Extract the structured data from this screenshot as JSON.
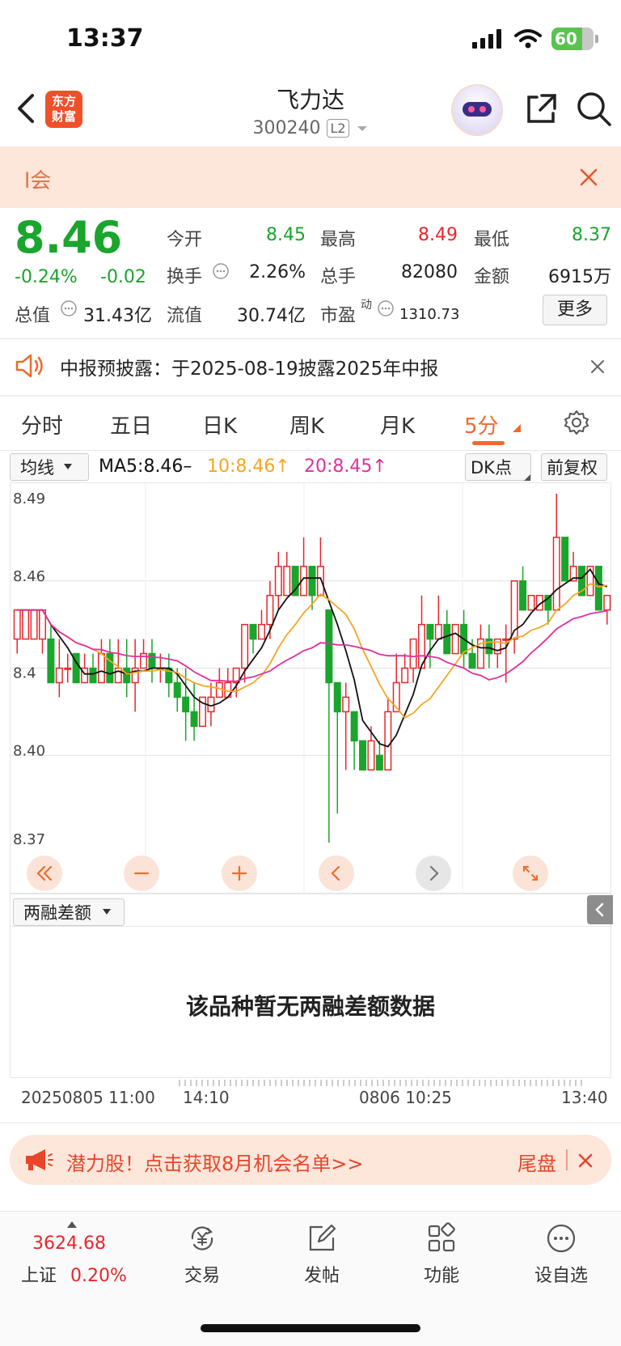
{
  "status": {
    "time": "13:37",
    "battery": "60"
  },
  "header": {
    "logo_line1": "东方",
    "logo_line2": "财富",
    "title": "飞力达",
    "code": "300240",
    "level": "L2"
  },
  "banner": {
    "text": "l会"
  },
  "quote": {
    "price": "8.46",
    "change_pct": "-0.24%",
    "change_abs": "-0.02",
    "open_label": "今开",
    "open": "8.45",
    "high_label": "最高",
    "high": "8.49",
    "low_label": "最低",
    "low": "8.37",
    "turnover_label": "换手",
    "turnover": "2.26%",
    "volume_label": "总手",
    "volume": "82080",
    "amount_label": "金额",
    "amount": "6915万",
    "mktcap_label": "总值",
    "mktcap": "31.43亿",
    "float_label": "流值",
    "float": "30.74亿",
    "pe_label": "市盈",
    "pe_sup": "动",
    "pe": "1310.73",
    "more": "更多"
  },
  "notice": {
    "text": "中报预披露：于2025-08-19披露2025年中报"
  },
  "tabs": [
    "分时",
    "五日",
    "日K",
    "周K",
    "月K",
    "5分"
  ],
  "indicator": {
    "selector": "均线",
    "ma5": "MA5:8.46–",
    "ma10": "10:8.46↑",
    "ma20": "20:8.45↑",
    "dk": "DK点",
    "adjust": "前复权"
  },
  "colors": {
    "up": "#e8262c",
    "down": "#1aa52c",
    "ma5": "#111111",
    "ma10": "#f5a623",
    "ma20": "#e0309a",
    "accent": "#ef6a2d"
  },
  "chart_data": {
    "type": "candlestick",
    "ylim": [
      8.37,
      8.49
    ],
    "yticks": [
      "8.49",
      "8.46",
      "8.4",
      "8.40",
      "8.37"
    ],
    "xticks": [
      "20250805 11:00",
      "14:10",
      "0806 10:25",
      "13:40"
    ],
    "candles": [
      [
        8.44,
        8.45,
        8.445,
        8.435
      ],
      [
        8.44,
        8.45,
        8.44,
        8.44
      ],
      [
        8.44,
        8.45,
        8.445,
        8.44
      ],
      [
        8.44,
        8.45,
        8.445,
        8.435
      ],
      [
        8.44,
        8.425,
        8.445,
        8.425
      ],
      [
        8.425,
        8.43,
        8.44,
        8.42
      ],
      [
        8.43,
        8.43,
        8.435,
        8.425
      ],
      [
        8.435,
        8.425,
        8.435,
        8.425
      ],
      [
        8.425,
        8.43,
        8.435,
        8.425
      ],
      [
        8.43,
        8.425,
        8.435,
        8.425
      ],
      [
        8.425,
        8.435,
        8.44,
        8.425
      ],
      [
        8.435,
        8.425,
        8.44,
        8.425
      ],
      [
        8.425,
        8.43,
        8.44,
        8.425
      ],
      [
        8.43,
        8.425,
        8.44,
        8.42
      ],
      [
        8.425,
        8.43,
        8.44,
        8.415
      ],
      [
        8.43,
        8.435,
        8.44,
        8.43
      ],
      [
        8.435,
        8.43,
        8.44,
        8.425
      ],
      [
        8.43,
        8.43,
        8.435,
        8.425
      ],
      [
        8.43,
        8.425,
        8.435,
        8.42
      ],
      [
        8.425,
        8.42,
        8.43,
        8.415
      ],
      [
        8.42,
        8.415,
        8.43,
        8.405
      ],
      [
        8.415,
        8.41,
        8.425,
        8.405
      ],
      [
        8.41,
        8.42,
        8.42,
        8.41
      ],
      [
        8.415,
        8.42,
        8.425,
        8.41
      ],
      [
        8.42,
        8.425,
        8.43,
        8.42
      ],
      [
        8.42,
        8.425,
        8.43,
        8.42
      ],
      [
        8.425,
        8.43,
        8.43,
        8.42
      ],
      [
        8.43,
        8.445,
        8.445,
        8.425
      ],
      [
        8.445,
        8.44,
        8.445,
        8.435
      ],
      [
        8.44,
        8.445,
        8.45,
        8.44
      ],
      [
        8.445,
        8.455,
        8.46,
        8.44
      ],
      [
        8.455,
        8.465,
        8.47,
        8.45
      ],
      [
        8.455,
        8.465,
        8.47,
        8.455
      ],
      [
        8.465,
        8.455,
        8.465,
        8.455
      ],
      [
        8.455,
        8.465,
        8.475,
        8.455
      ],
      [
        8.465,
        8.455,
        8.465,
        8.45
      ],
      [
        8.455,
        8.465,
        8.475,
        8.455
      ],
      [
        8.45,
        8.425,
        8.45,
        8.37
      ],
      [
        8.425,
        8.415,
        8.425,
        8.38
      ],
      [
        8.415,
        8.42,
        8.425,
        8.395
      ],
      [
        8.415,
        8.405,
        8.415,
        8.395
      ],
      [
        8.405,
        8.395,
        8.405,
        8.395
      ],
      [
        8.395,
        8.405,
        8.41,
        8.395
      ],
      [
        8.4,
        8.395,
        8.405,
        8.395
      ],
      [
        8.395,
        8.415,
        8.42,
        8.395
      ],
      [
        8.415,
        8.425,
        8.435,
        8.415
      ],
      [
        8.425,
        8.43,
        8.435,
        8.425
      ],
      [
        8.43,
        8.44,
        8.44,
        8.425
      ],
      [
        8.43,
        8.445,
        8.455,
        8.43
      ],
      [
        8.445,
        8.44,
        8.445,
        8.43
      ],
      [
        8.44,
        8.445,
        8.455,
        8.44
      ],
      [
        8.445,
        8.435,
        8.45,
        8.435
      ],
      [
        8.435,
        8.445,
        8.445,
        8.435
      ],
      [
        8.445,
        8.435,
        8.45,
        8.43
      ],
      [
        8.435,
        8.43,
        8.44,
        8.43
      ],
      [
        8.43,
        8.44,
        8.445,
        8.43
      ],
      [
        8.44,
        8.435,
        8.445,
        8.43
      ],
      [
        8.435,
        8.44,
        8.44,
        8.43
      ],
      [
        8.44,
        8.44,
        8.445,
        8.425
      ],
      [
        8.44,
        8.46,
        8.46,
        8.435
      ],
      [
        8.46,
        8.45,
        8.465,
        8.45
      ],
      [
        8.45,
        8.455,
        8.455,
        8.45
      ],
      [
        8.45,
        8.455,
        8.455,
        8.45
      ],
      [
        8.455,
        8.45,
        8.455,
        8.445
      ],
      [
        8.45,
        8.475,
        8.49,
        8.45
      ],
      [
        8.475,
        8.46,
        8.475,
        8.46
      ],
      [
        8.46,
        8.465,
        8.47,
        8.46
      ],
      [
        8.465,
        8.455,
        8.465,
        8.455
      ],
      [
        8.455,
        8.465,
        8.465,
        8.455
      ],
      [
        8.465,
        8.45,
        8.465,
        8.45
      ],
      [
        8.45,
        8.455,
        8.455,
        8.445
      ]
    ]
  },
  "sub_panel": {
    "selector": "两融差额",
    "no_data": "该品种暂无两融差额数据"
  },
  "promo": {
    "text": "潜力股！点击获取8月机会名单>>",
    "right": "尾盘"
  },
  "bottom_nav": {
    "index_value": "3624.68",
    "index_name": "上证",
    "index_pct": "0.20%",
    "items": [
      "交易",
      "发帖",
      "功能",
      "设自选"
    ]
  }
}
